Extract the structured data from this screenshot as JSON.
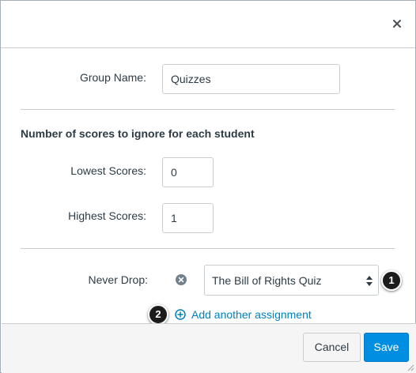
{
  "dialog": {
    "close_icon": "close-icon"
  },
  "group": {
    "name_label": "Group Name:",
    "name_value": "Quizzes"
  },
  "scores": {
    "heading": "Number of scores to ignore for each student",
    "lowest_label": "Lowest Scores:",
    "lowest_value": "0",
    "highest_label": "Highest Scores:",
    "highest_value": "1"
  },
  "never_drop": {
    "label": "Never Drop:",
    "remove_icon": "remove-circle-icon",
    "selected_assignment": "The Bill of Rights Quiz",
    "callout_select": "1",
    "add_link": "Add another assignment",
    "add_icon": "plus-circle-icon",
    "callout_add": "2"
  },
  "footer": {
    "cancel_label": "Cancel",
    "save_label": "Save"
  },
  "colors": {
    "primary": "#008ee2",
    "link": "#0081bd",
    "text": "#2d3b45",
    "callout": "#1c1c1c"
  }
}
